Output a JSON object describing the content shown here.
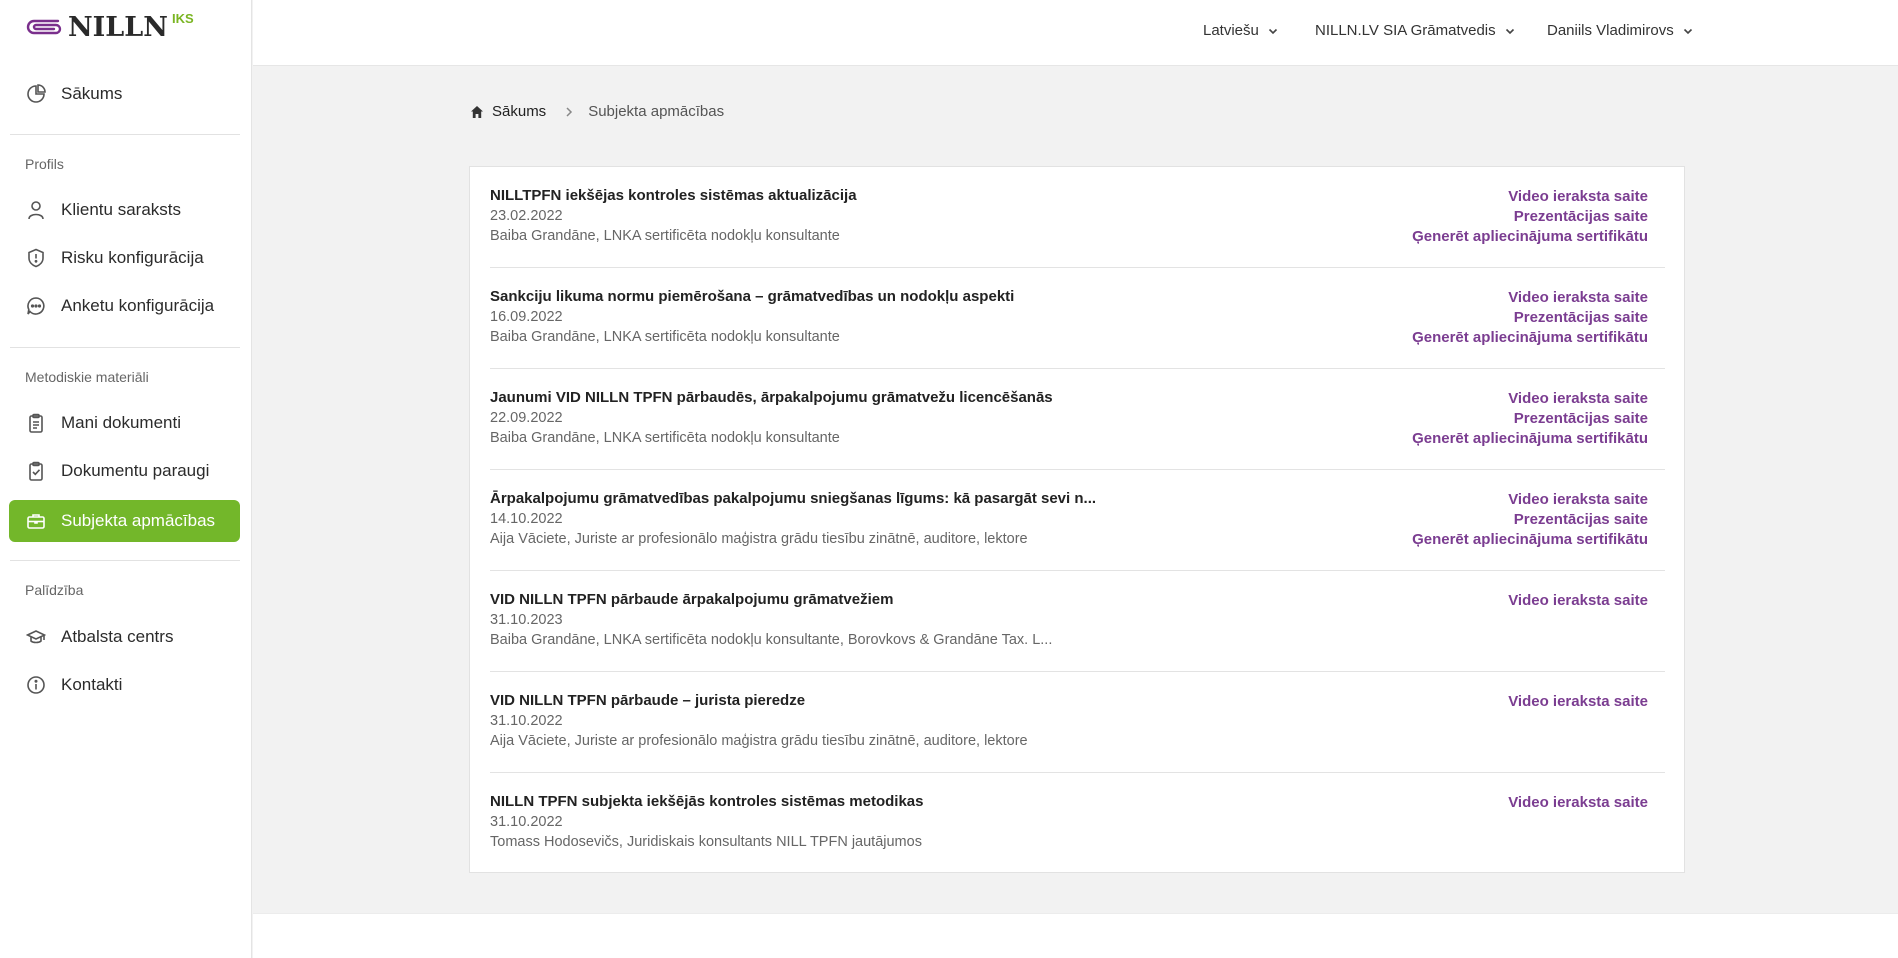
{
  "brand": {
    "name": "NILLN",
    "tag": "IKS"
  },
  "nav": {
    "home": "Sākums",
    "section_profile": "Profils",
    "clients": "Klientu saraksts",
    "risk": "Risku konfigurācija",
    "survey": "Anketu konfigurācija",
    "section_methods": "Metodiskie materiāli",
    "my_docs": "Mani dokumenti",
    "doc_samples": "Dokumentu paraugi",
    "training": "Subjekta apmācības",
    "section_help": "Palīdzība",
    "support": "Atbalsta centrs",
    "contacts": "Kontakti"
  },
  "topbar": {
    "language": "Latviešu",
    "company": "NILLN.LV SIA Grāmatvedis",
    "user": "Daniils Vladimirovs"
  },
  "breadcrumb": {
    "home": "Sākums",
    "current": "Subjekta apmācības"
  },
  "trainings": [
    {
      "title": "NILLTPFN iekšējas kontroles sistēmas aktualizācija",
      "date": "23.02.2022",
      "author": "Baiba Grandāne, LNKA sertificēta nodokļu konsultante",
      "video": "Video ieraksta saite",
      "presentation": "Prezentācijas saite",
      "certificate": "Ģenerēt apliecinājuma sertifikātu"
    },
    {
      "title": "Sankciju likuma normu piemērošana – grāmatvedības un nodokļu aspekti",
      "date": "16.09.2022",
      "author": "Baiba Grandāne, LNKA sertificēta nodokļu konsultante",
      "video": "Video ieraksta saite",
      "presentation": "Prezentācijas saite",
      "certificate": "Ģenerēt apliecinājuma sertifikātu"
    },
    {
      "title": "Jaunumi VID NILLN TPFN pārbaudēs, ārpakalpojumu grāmatvežu licencēšanās",
      "date": "22.09.2022",
      "author": "Baiba Grandāne, LNKA sertificēta nodokļu konsultante",
      "video": "Video ieraksta saite",
      "presentation": "Prezentācijas saite",
      "certificate": "Ģenerēt apliecinājuma sertifikātu"
    },
    {
      "title": "Ārpakalpojumu grāmatvedības pakalpojumu sniegšanas līgums: kā pasargāt sevi n...",
      "date": "14.10.2022",
      "author": "Aija Vāciete, Juriste ar profesionālo maģistra grādu tiesību zinātnē, auditore, lektore",
      "video": "Video ieraksta saite",
      "presentation": "Prezentācijas saite",
      "certificate": "Ģenerēt apliecinājuma sertifikātu"
    },
    {
      "title": "VID NILLN TPFN pārbaude ārpakalpojumu grāmatvežiem",
      "date": "31.10.2023",
      "author": "Baiba Grandāne, LNKA sertificēta nodokļu konsultante, Borovkovs & Grandāne Tax. L...",
      "video": "Video ieraksta saite"
    },
    {
      "title": "VID NILLN TPFN pārbaude – jurista pieredze",
      "date": "31.10.2022",
      "author": "Aija Vāciete, Juriste ar profesionālo maģistra grādu tiesību zinātnē, auditore, lektore",
      "video": "Video ieraksta saite"
    },
    {
      "title": "NILLN TPFN subjekta iekšējās kontroles sistēmas metodikas",
      "date": "31.10.2022",
      "author": "Tomass Hodosevičs, Juridiskais konsultants NILL TPFN jautājumos",
      "video": "Video ieraksta saite"
    }
  ],
  "colors": {
    "accent_green": "#73b72a",
    "link_purple": "#7b3d91",
    "logo_purple": "#7a2f8c"
  }
}
